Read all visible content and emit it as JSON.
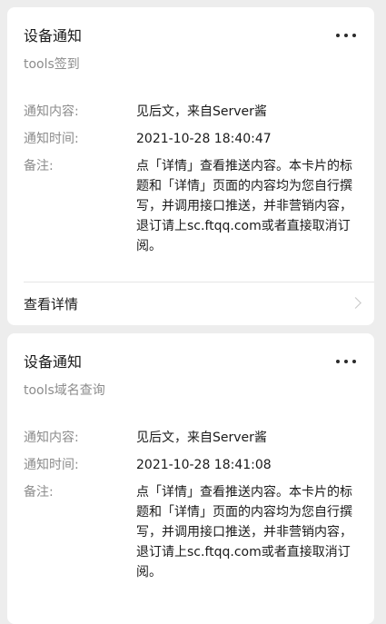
{
  "cards": [
    {
      "title": "设备通知",
      "subtitle": "tools签到",
      "fields": [
        {
          "label": "通知内容:",
          "value": "见后文，来自Server酱"
        },
        {
          "label": "通知时间:",
          "value": "2021-10-28 18:40:47"
        },
        {
          "label": "备注:",
          "value": "点「详情」查看推送内容。本卡片的标题和「详情」页面的内容均为您自行撰写，并调用接口推送，并非营销内容，退订请上sc.ftqq.com或者直接取消订阅。"
        }
      ],
      "footer_label": "查看详情",
      "icons": {
        "more": "more-icon",
        "chevron": "chevron-right-icon"
      }
    },
    {
      "title": "设备通知",
      "subtitle": "tools域名查询",
      "fields": [
        {
          "label": "通知内容:",
          "value": "见后文，来自Server酱"
        },
        {
          "label": "通知时间:",
          "value": "2021-10-28 18:41:08"
        },
        {
          "label": "备注:",
          "value": "点「详情」查看推送内容。本卡片的标题和「详情」页面的内容均为您自行撰写，并调用接口推送，并非营销内容，退订请上sc.ftqq.com或者直接取消订阅。"
        }
      ],
      "icons": {
        "more": "more-icon"
      }
    }
  ]
}
